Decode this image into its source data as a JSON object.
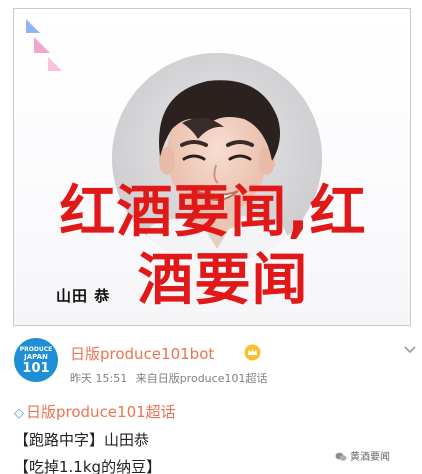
{
  "photo": {
    "overlay_line1": "红酒要闻,红",
    "overlay_line2": "酒要闻",
    "name_badge": "山田 恭"
  },
  "post": {
    "avatar": {
      "line_top": "PRODUCE",
      "line_mid": "JAPAN",
      "line_num": "101"
    },
    "account_name": "日版produce101bot",
    "meta": {
      "time": "昨天 15:51",
      "source": "来自日版produce101超话"
    },
    "supertopic": "日版produce101超话",
    "line1": "【跑路中字】山田恭",
    "line2": "【吃掉1.1kg的纳豆】",
    "watermark": "黄酒要闻"
  },
  "icons": {
    "verified": "crown-badge-icon",
    "chevron": "chevron-down-icon",
    "supertopic": "diamond-icon",
    "watermark": "wechat-icon"
  },
  "colors": {
    "overlay_red": "#e01818",
    "weibo_orange": "#eb7350",
    "avatar_blue": "#1e8fd6",
    "meta_gray": "#808080"
  }
}
